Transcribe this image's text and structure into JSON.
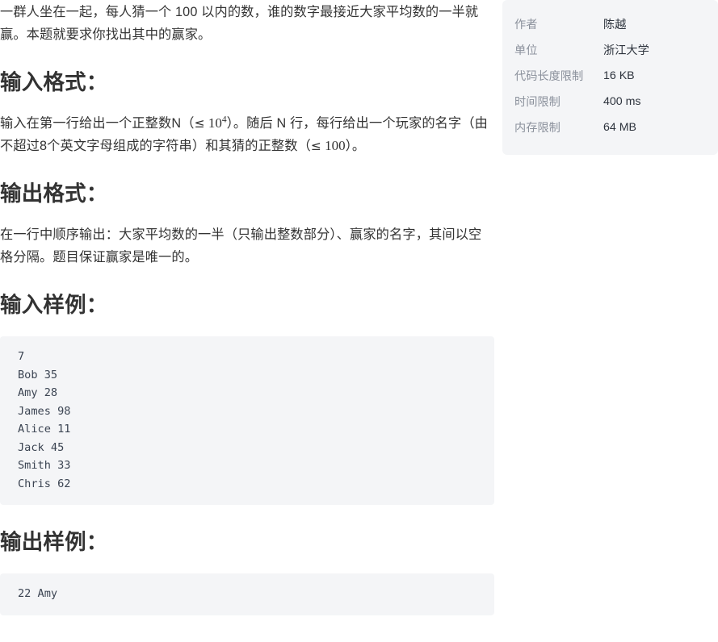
{
  "problem": {
    "description": "一群人坐在一起，每人猜一个 100 以内的数，谁的数字最接近大家平均数的一半就赢。本题就要求你找出其中的赢家。",
    "input_format": {
      "heading": "输入格式：",
      "text_part1": "输入在第一行给出一个正整数N（",
      "math1_le": "≤",
      "math1_base": "10",
      "math1_exp": "4",
      "text_part2": "）。随后 N 行，每行给出一个玩家的名字（由不超过8个英文字母组成的字符串）和其猜的正整数（",
      "math2_le": "≤",
      "math2_value": "100",
      "text_part3": "）。"
    },
    "output_format": {
      "heading": "输出格式：",
      "text": "在一行中顺序输出：大家平均数的一半（只输出整数部分）、赢家的名字，其间以空格分隔。题目保证赢家是唯一的。"
    },
    "input_sample": {
      "heading": "输入样例：",
      "code": "7\nBob 35\nAmy 28\nJames 98\nAlice 11\nJack 45\nSmith 33\nChris 62"
    },
    "output_sample": {
      "heading": "输出样例：",
      "code": "22 Amy"
    }
  },
  "info_panel": {
    "rows": [
      {
        "label": "作者",
        "value": "陈越"
      },
      {
        "label": "单位",
        "value": "浙江大学"
      },
      {
        "label": "代码长度限制",
        "value": "16 KB"
      },
      {
        "label": "时间限制",
        "value": "400 ms"
      },
      {
        "label": "内存限制",
        "value": "64 MB"
      }
    ]
  },
  "colors": {
    "panel_bg": "#f4f5f7",
    "heading": "#333333",
    "body_text": "#333333",
    "label_text": "#8b919c",
    "code_text": "#3b4452"
  }
}
